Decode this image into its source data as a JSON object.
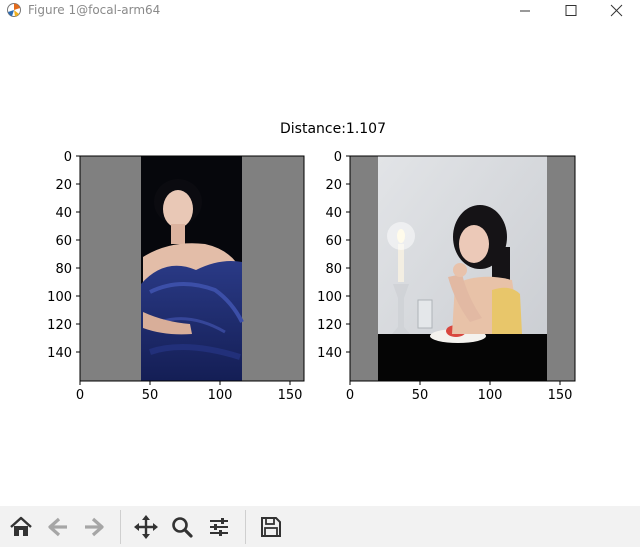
{
  "window": {
    "title": "Figure 1@focal-arm64",
    "controls": [
      "minimize-icon",
      "maximize-icon",
      "close-icon"
    ]
  },
  "figure": {
    "title": "Distance:1.107",
    "subplots": [
      {
        "name": "left-image",
        "xticks": [
          "0",
          "50",
          "100",
          "150"
        ],
        "yticks": [
          "0",
          "20",
          "40",
          "60",
          "80",
          "100",
          "120",
          "140"
        ],
        "content": "portrait of woman in blue off-shoulder gown on dark background, gray padding on both sides"
      },
      {
        "name": "right-image",
        "xticks": [
          "0",
          "50",
          "100",
          "150"
        ],
        "yticks": [
          "0",
          "20",
          "40",
          "60",
          "80",
          "100",
          "120",
          "140"
        ],
        "content": "portrait of woman at table with candles and dessert plate, gray padding on both sides"
      }
    ]
  },
  "toolbar": {
    "buttons": [
      "home-icon",
      "back-icon",
      "forward-icon",
      "pan-icon",
      "zoom-icon",
      "configure-subplots-icon",
      "save-icon"
    ]
  },
  "colors": {
    "padding_gray": "#808080",
    "toolbar_bg": "#f2f2f2"
  }
}
